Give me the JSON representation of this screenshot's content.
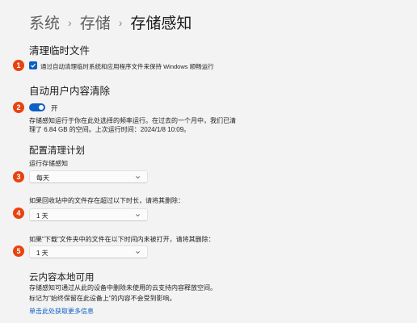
{
  "breadcrumb": {
    "items": [
      "系统",
      "存储",
      "存储感知"
    ],
    "separator": "›"
  },
  "sections": {
    "cleanup_temp": {
      "title": "清理临时文件",
      "checkbox_label": "通过自动清理临时系统和应用程序文件来保持 Windows 顺畅运行",
      "checked": true,
      "badge": "1"
    },
    "auto_cleanup": {
      "title": "自动用户内容清除",
      "toggle_label": "开",
      "toggle_on": true,
      "badge": "2",
      "desc_line1": "存储感知运行于你在此处选择的频率运行。在过去的一个月中，我们已清",
      "desc_line2": "理了 6.84 GB 的空间。上次运行时间：2024/1/8 10:09。"
    },
    "schedule": {
      "title": "配置清理计划",
      "run_label": "运行存储感知",
      "run_value": "每天",
      "badge_run": "3",
      "recycle_label": "如果回收站中的文件存在超过以下时长，请将其删除：",
      "recycle_value": "1 天",
      "badge_recycle": "4",
      "downloads_label": "如果\"下载\"文件夹中的文件在以下时间内未被打开，请将其删除：",
      "downloads_value": "1 天",
      "badge_downloads": "5"
    },
    "cloud": {
      "title": "云内容本地可用",
      "desc_line1": "存储感知可通过从此的设备中删除未使用的云支持内容释放空间。",
      "desc_line2": "标记为\"始终保留在此设备上\"的内容不会受到影响。",
      "link": "单击此处获取更多信息"
    }
  },
  "colors": {
    "accent": "#0c5fc4",
    "badge": "#e8420f",
    "link": "#0b5ec7"
  }
}
